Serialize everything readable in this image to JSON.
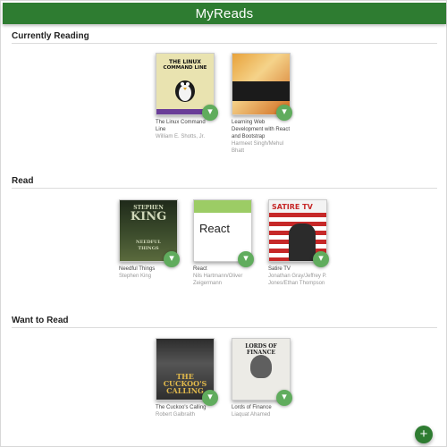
{
  "app": {
    "title": "MyReads"
  },
  "shelves": [
    {
      "title": "Currently Reading",
      "books": [
        {
          "title": "The Linux Command Line",
          "authors": "William E. Shotts, Jr.",
          "cover_text": [
            "THE LINUX",
            "COMMAND LINE"
          ]
        },
        {
          "title": "Learning Web Development with React and Bootstrap",
          "authors": "Harmeet Singh/Mehul Bhatt"
        }
      ]
    },
    {
      "title": "Read",
      "books": [
        {
          "title": "Needful Things",
          "authors": "Stephen King",
          "cover_text": [
            "STEPHEN",
            "KING",
            "NEEDFUL",
            "THINGS"
          ]
        },
        {
          "title": "React",
          "authors": "Nils Hartmann/Oliver Zeigermann",
          "cover_text": [
            "React"
          ]
        },
        {
          "title": "Satire TV",
          "authors": "Jonathan Gray/Jeffrey P. Jones/Ethan Thompson",
          "cover_text": [
            "SATIRE TV"
          ]
        }
      ]
    },
    {
      "title": "Want to Read",
      "books": [
        {
          "title": "The Cuckoo's Calling",
          "authors": "Robert Galbraith",
          "cover_text": [
            "THE",
            "CUCKOO'S",
            "CALLING"
          ]
        },
        {
          "title": "Lords of Finance",
          "authors": "Liaquat Ahamed",
          "cover_text": [
            "LORDS OF FINANCE"
          ]
        }
      ]
    }
  ],
  "controls": {
    "change_shelf_icon": "▾",
    "add_icon": "+"
  },
  "colors": {
    "header": "#2e7c31",
    "accent": "#60ac5d"
  }
}
